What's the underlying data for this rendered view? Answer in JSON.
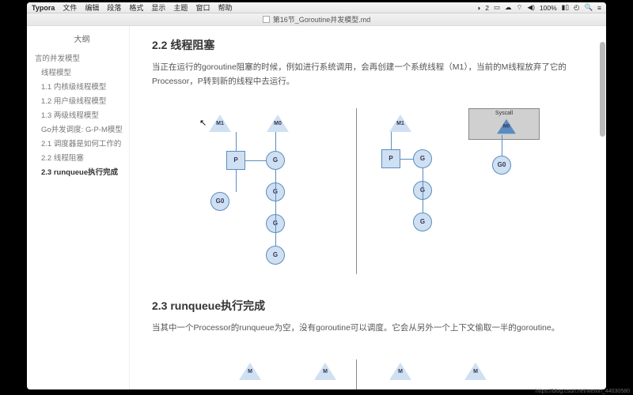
{
  "menubar": {
    "app": "Typora",
    "items": [
      "文件",
      "编辑",
      "段落",
      "格式",
      "显示",
      "主题",
      "窗口",
      "帮助"
    ],
    "status": {
      "count": "2",
      "battery": "100%",
      "time_icon": "◴"
    }
  },
  "titlebar": {
    "filename": "第16节_Goroutine并发模型.md"
  },
  "sidebar": {
    "title": "大纲",
    "items": [
      {
        "label": "言的并发模型",
        "lvl": 0
      },
      {
        "label": "线程模型",
        "lvl": 1
      },
      {
        "label": "1.1 内核级线程模型",
        "lvl": 1
      },
      {
        "label": "1.2 用户级线程模型",
        "lvl": 1
      },
      {
        "label": "1.3 两级线程模型",
        "lvl": 1
      },
      {
        "label": "Go并发调度: G-P-M模型",
        "lvl": 1
      },
      {
        "label": "2.1 调度器是如何工作的",
        "lvl": 1
      },
      {
        "label": "2.2 线程阻塞",
        "lvl": 1
      },
      {
        "label": "2.3 runqueue执行完成",
        "lvl": 1,
        "current": true
      }
    ]
  },
  "content": {
    "h22": "2.2 线程阻塞",
    "p22": "当正在运行的goroutine阻塞的时候，例如进行系统调用，会再创建一个系统线程（M1），当前的M线程放弃了它的Processor，P转到新的线程中去运行。",
    "h23": "2.3 runqueue执行完成",
    "p23": "当其中一个Processor的runqueue为空，没有goroutine可以调度。它会从另外一个上下文偷取一半的goroutine。"
  },
  "nodes": {
    "M": "M",
    "M0": "M0",
    "M1": "M1",
    "P": "P",
    "G": "G",
    "G0": "G0",
    "Syscall": "Syscall"
  },
  "footer": {
    "url": "https://blog.csdn.net/weixin_44030580"
  }
}
